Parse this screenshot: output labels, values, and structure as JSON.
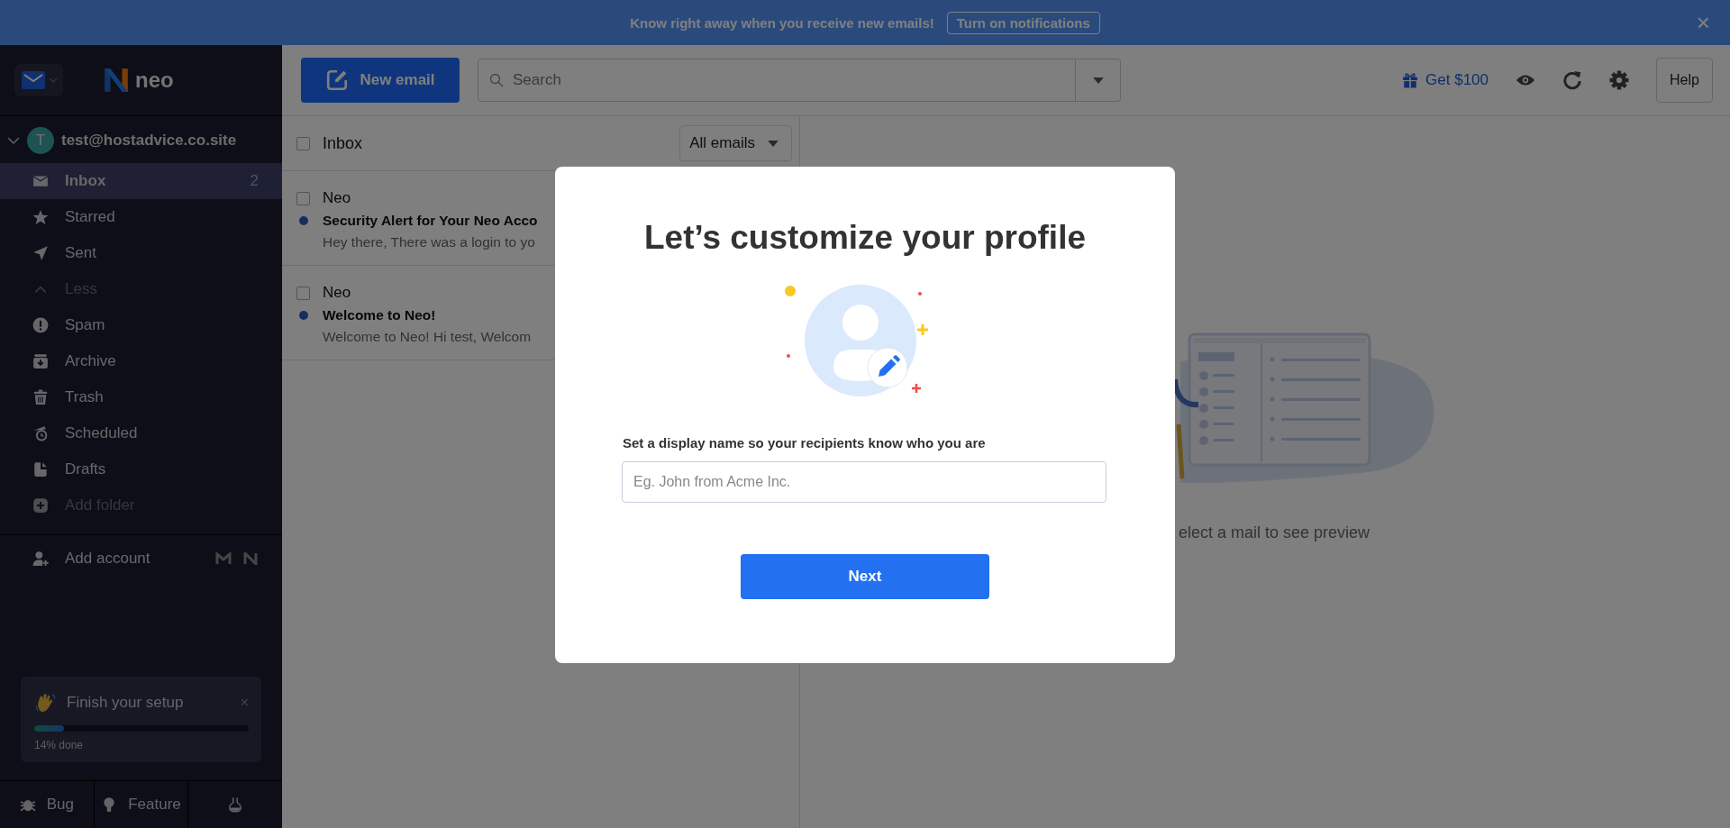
{
  "banner": {
    "message": "Know right away when you receive new emails!",
    "button": "Turn on notifications",
    "close": "×"
  },
  "sidebar": {
    "logo": "neo",
    "account": {
      "initial": "T",
      "email": "test@hostadvice.co.site",
      "expanded": true
    },
    "items": [
      {
        "kind": "folder",
        "label": "Inbox",
        "count": "2",
        "selected": true
      },
      {
        "kind": "folder",
        "label": "Starred",
        "selected": false
      },
      {
        "kind": "folder",
        "label": "Sent",
        "selected": false
      },
      {
        "kind": "toggle",
        "label": "Less",
        "selected": false
      },
      {
        "kind": "folder",
        "label": "Spam",
        "selected": false
      },
      {
        "kind": "folder",
        "label": "Archive",
        "selected": false
      },
      {
        "kind": "folder",
        "label": "Trash",
        "selected": false
      },
      {
        "kind": "folder",
        "label": "Scheduled",
        "selected": false
      },
      {
        "kind": "folder",
        "label": "Drafts",
        "selected": false
      },
      {
        "kind": "action",
        "label": "Add folder",
        "selected": false
      }
    ],
    "add_account": "Add account",
    "setup": {
      "title": "Finish your setup",
      "close": "×",
      "level": 0.14,
      "progress_text": "14% done"
    },
    "footer": [
      "Bug",
      "Feature"
    ]
  },
  "toolbar": {
    "new_email": "New email",
    "search": {
      "placeholder": "Search"
    },
    "reward": "Get $100",
    "help": "Help"
  },
  "list": {
    "title": "Inbox",
    "select_all": {
      "checked": false
    },
    "filter": "All emails",
    "emails": [
      {
        "sender": "Neo",
        "subject": "Security Alert for Your Neo Acco",
        "preview": "Hey there, There was a login to yo",
        "unread": true,
        "checked": false
      },
      {
        "sender": "Neo",
        "subject": "Welcome to Neo!",
        "preview": "Welcome to Neo! Hi test, Welcom",
        "unread": true,
        "checked": false
      }
    ]
  },
  "preview": {
    "hint": "elect a mail to see preview"
  },
  "modal": {
    "title": "Let’s customize your profile",
    "label": "Set a display name so your recipients know who you are",
    "field": {
      "placeholder": "Eg. John from Acme Inc."
    },
    "button": "Next"
  }
}
